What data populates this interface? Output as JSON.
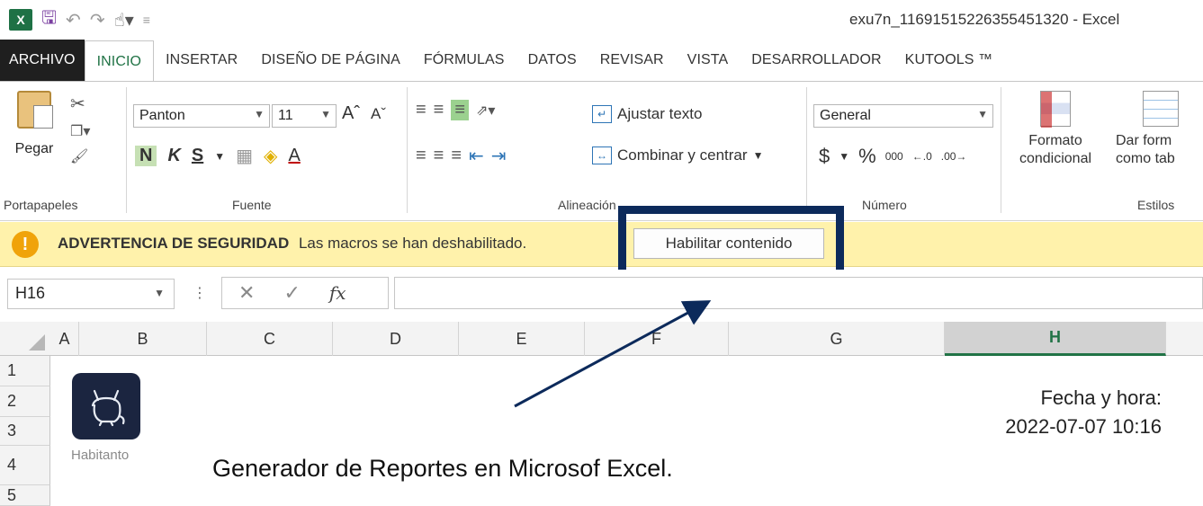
{
  "title_bar": {
    "window_title": "exu7n_11691515226355451320 - Excel"
  },
  "tabs": [
    {
      "label": "ARCHIVO"
    },
    {
      "label": "INICIO"
    },
    {
      "label": "INSERTAR"
    },
    {
      "label": "DISEÑO DE PÁGINA"
    },
    {
      "label": "FÓRMULAS"
    },
    {
      "label": "DATOS"
    },
    {
      "label": "REVISAR"
    },
    {
      "label": "VISTA"
    },
    {
      "label": "DESARROLLADOR"
    },
    {
      "label": "KUTOOLS ™"
    }
  ],
  "ribbon": {
    "clipboard": {
      "paste_label": "Pegar",
      "group_label": "Portapapeles"
    },
    "font": {
      "font_name": "Panton",
      "font_size": "11",
      "bold": "N",
      "italic": "K",
      "underline": "S",
      "group_label": "Fuente"
    },
    "alignment": {
      "wrap_text": "Ajustar texto",
      "merge_center": "Combinar y centrar",
      "group_label": "Alineación"
    },
    "number": {
      "format": "General",
      "currency": "$",
      "percent": "%",
      "thousands": "000",
      "group_label": "Número"
    },
    "styles": {
      "conditional_line1": "Formato",
      "conditional_line2": "condicional",
      "table_line1": "Dar form",
      "table_line2": "como tab",
      "group_label": "Estilos"
    }
  },
  "security_bar": {
    "heading": "ADVERTENCIA DE SEGURIDAD",
    "message": "Las macros se han deshabilitado.",
    "button": "Habilitar contenido"
  },
  "formula_bar": {
    "name_box": "H16",
    "fx": "fx",
    "value": ""
  },
  "grid": {
    "columns": [
      "A",
      "B",
      "C",
      "D",
      "E",
      "F",
      "G",
      "H"
    ],
    "selected_column": "H",
    "rows": [
      "1",
      "2",
      "3",
      "4",
      "5"
    ]
  },
  "sheet": {
    "logo_caption": "Habitanto",
    "report_title": "Generador de Reportes en Microsof Excel.",
    "datetime_label": "Fecha y hora:",
    "datetime_value": "2022-07-07 10:16"
  },
  "colors": {
    "excel_green": "#217346",
    "warning_yellow": "#fff2ab",
    "frame_navy": "#0c2a5b"
  }
}
